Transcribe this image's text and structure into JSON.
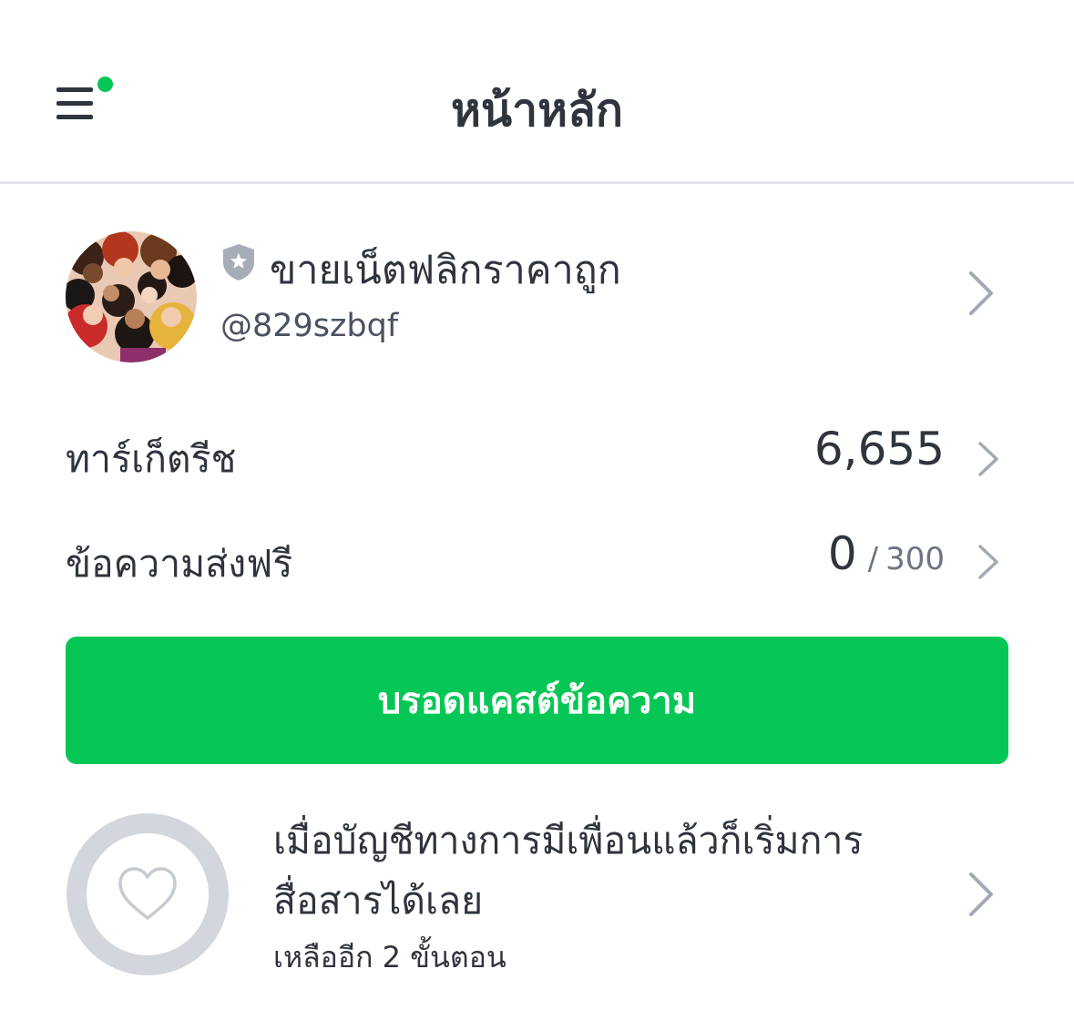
{
  "header": {
    "title": "หน้าหลัก",
    "menu_icon": "hamburger-menu-icon",
    "notification_dot_color": "#06c755"
  },
  "account": {
    "name": "ขายเน็ตฟลิกราคาถูก",
    "id": "@829szbqf",
    "badge_icon": "verified-shield-icon",
    "avatar": "avatar-image"
  },
  "stats": {
    "target_reach": {
      "label": "ทาร์เก็ตรีช",
      "value": "6,655"
    },
    "free_messages": {
      "label": "ข้อความส่งฟรี",
      "used": "0",
      "separator": "/",
      "limit": "300"
    }
  },
  "broadcast": {
    "label": "บรอดแคสต์ข้อความ",
    "color": "#06c755"
  },
  "onboarding": {
    "title": "เมื่อบัญชีทางการมีเพื่อนแล้วก็เริ่มการสื่อสารได้เลย",
    "subtitle": "เหลืออีก 2 ขั้นตอน",
    "icon": "heart-icon"
  }
}
